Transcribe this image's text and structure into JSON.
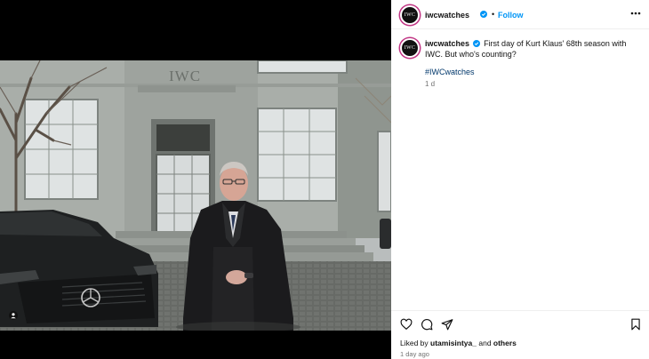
{
  "post": {
    "username": "iwcwatches",
    "follow_label": "Follow",
    "dot": "•",
    "avatar_text": "IWC",
    "caption": "First day of Kurt Klaus' 68th season with IWC. But who's counting?",
    "hashtag": "#IWCwatches",
    "caption_age": "1 d",
    "likes_prefix": "Liked by ",
    "likes_user": "utamisintya_",
    "likes_mid": " and ",
    "likes_others": "others",
    "timestamp": "1 day ago",
    "building_sign": "IWC"
  },
  "icons": {
    "more": "more-options-icon",
    "like": "heart-icon",
    "comment": "comment-icon",
    "share": "share-icon",
    "save": "bookmark-icon",
    "verified": "verified-badge-icon",
    "tag": "user-tag-icon"
  },
  "colors": {
    "follow": "#0095f6",
    "verified": "#0095f6",
    "hashtag": "#00376b",
    "muted": "#737373"
  }
}
